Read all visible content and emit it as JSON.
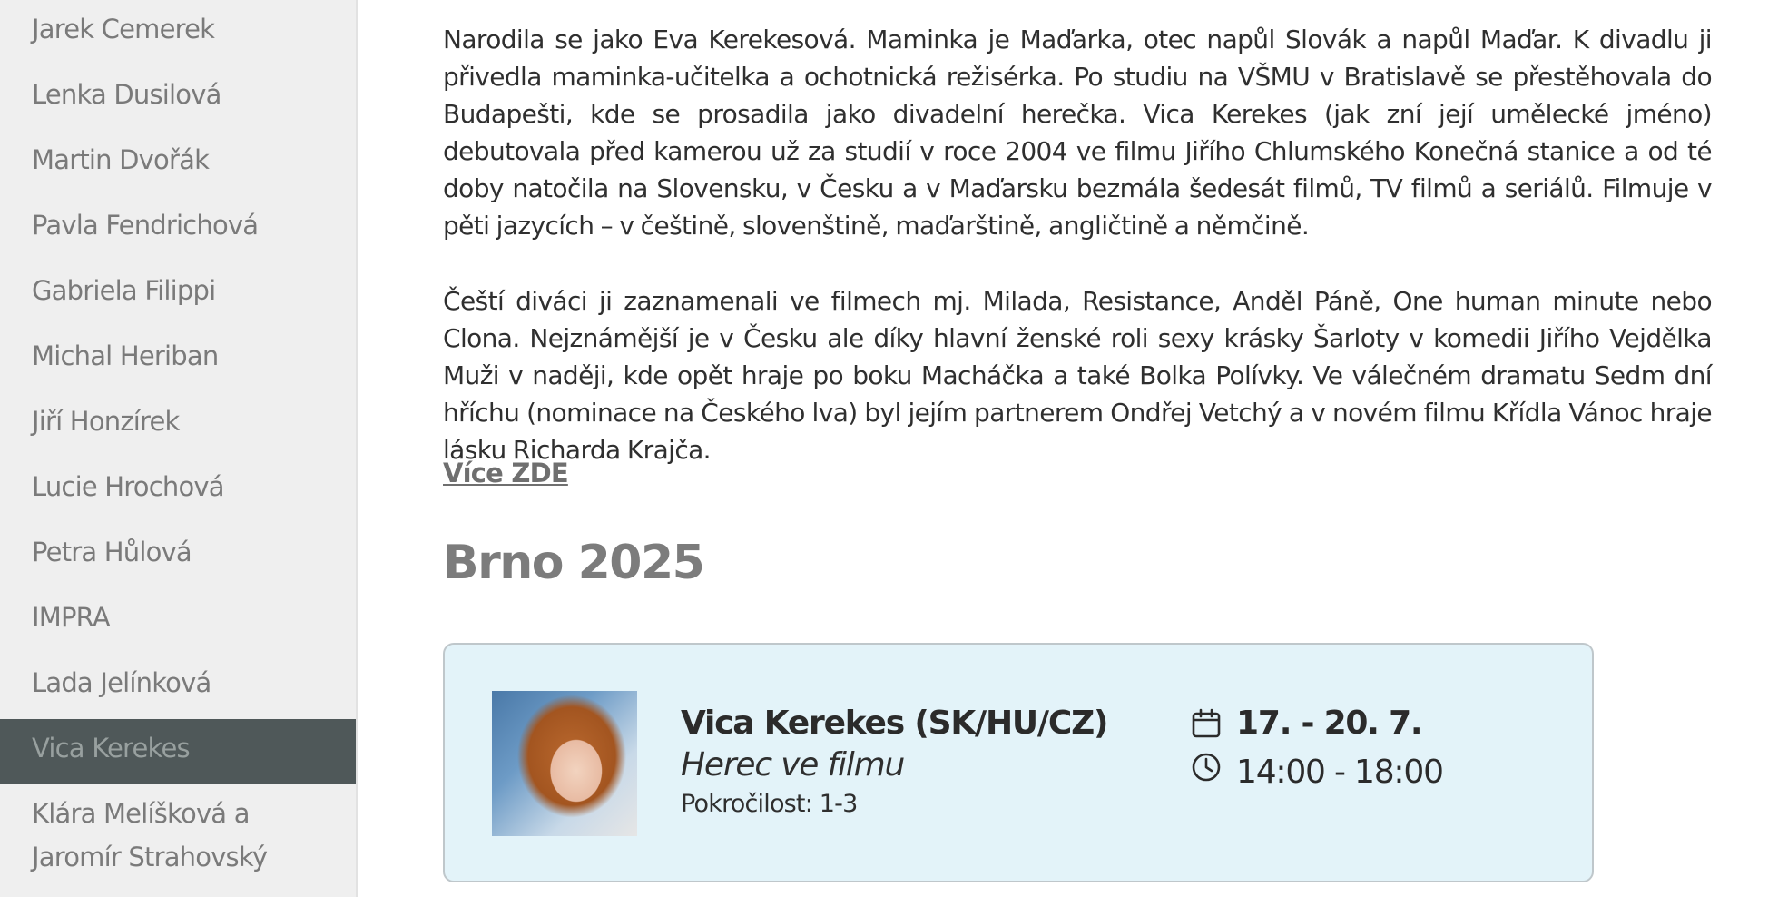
{
  "sidebar": {
    "items": [
      {
        "label": "Jarek Cemerek"
      },
      {
        "label": "Lenka Dusilová"
      },
      {
        "label": "Martin Dvořák"
      },
      {
        "label": "Pavla Fendrichová"
      },
      {
        "label": "Gabriela Filippi"
      },
      {
        "label": "Michal Heriban"
      },
      {
        "label": "Jiří Honzírek"
      },
      {
        "label": "Lucie Hrochová"
      },
      {
        "label": "Petra Hůlová"
      },
      {
        "label": "IMPRA"
      },
      {
        "label": "Lada Jelínková"
      },
      {
        "label": "Vica Kerekes"
      },
      {
        "label": "Klára Melíšková a Jaromír Strahovský"
      }
    ],
    "active_label": "Vica Kerekes"
  },
  "main": {
    "bio_paragraph_1": "Narodila se jako Eva Kerekesová. Maminka je Maďarka, otec napůl Slovák a napůl Maďar. K divadlu ji přivedla maminka-učitelka a ochotnická režisérka. Po studiu na VŠMU v Bratislavě se přestěhovala do Budapešti, kde se prosadila jako divadelní herečka. Vica Kerekes (jak zní její umělecké jméno) debutovala před kamerou už za studií v roce 2004 ve filmu Jiřího Chlumského Konečná stanice a od té doby natočila na Slovensku, v Česku a v Maďarsku bezmála šedesát filmů, TV filmů a seriálů. Filmuje v pěti jazycích – v češtině, slovenštině, maďarštině, angličtině a němčině.",
    "bio_paragraph_2": "Čeští diváci ji zaznamenali ve filmech mj. Milada, Resistance, Anděl Páně, One human minute nebo Clona. Nejznámější je v Česku ale díky hlavní ženské roli sexy krásky Šarloty v komedii Jiřího Vejdělka Muži v naději, kde opět hraje po boku Macháčka a také Bolka Polívky. Ve válečném dramatu Sedm dní hříchu (nominace na Českého lva) byl jejím partnerem Ondřej Vetchý a v novém filmu Křídla Vánoc hraje lásku Richarda Krajča.",
    "more_link": "Více ZDE",
    "section_title": "Brno 2025"
  },
  "card": {
    "title": "Vica Kerekes (SK/HU/CZ)",
    "subtitle": "Herec ve filmu",
    "level": "Pokročilost: 1-3",
    "date": "17. - 20. 7.",
    "time": "14:00 - 18:00",
    "icons": [
      "calendar-icon",
      "clock-icon"
    ]
  },
  "colors": {
    "sidebar_bg": "#efefef",
    "sidebar_active_bg": "#4f5859",
    "card_bg": "#e3f3f9",
    "heading": "#7c7c7c"
  }
}
